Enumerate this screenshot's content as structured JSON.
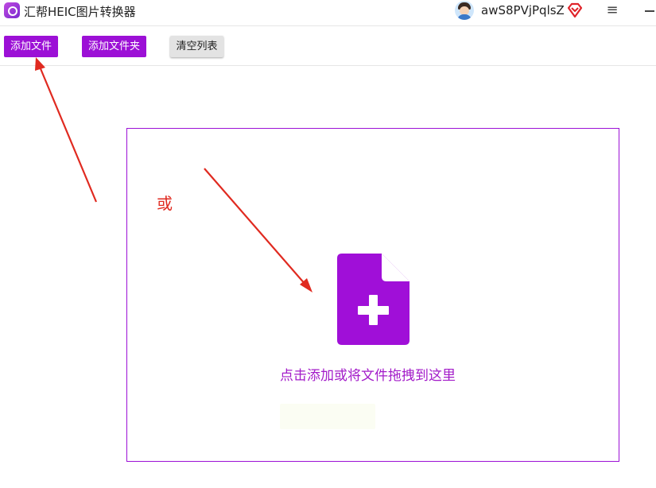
{
  "window": {
    "title": "汇帮HEIC图片转换器",
    "username": "awS8PVjPqlsZ",
    "icons": {
      "app_logo": "app-logo-icon",
      "avatar": "avatar",
      "vip": "vip-diamond-icon",
      "menu": "hamburger-menu-icon",
      "minimize": "minimize-icon"
    }
  },
  "toolbar": {
    "add_file_label": "添加文件",
    "add_folder_label": "添加文件夹",
    "clear_list_label": "清空列表"
  },
  "drop_zone": {
    "icon": "file-add-icon",
    "hint": "点击添加或将文件拖拽到这里",
    "faint_button_label": ""
  },
  "annotation": {
    "or_text": "或"
  },
  "colors": {
    "accent": "#9c10d6",
    "hint_text": "#a31cc9",
    "annotation_red": "#e02a20"
  }
}
